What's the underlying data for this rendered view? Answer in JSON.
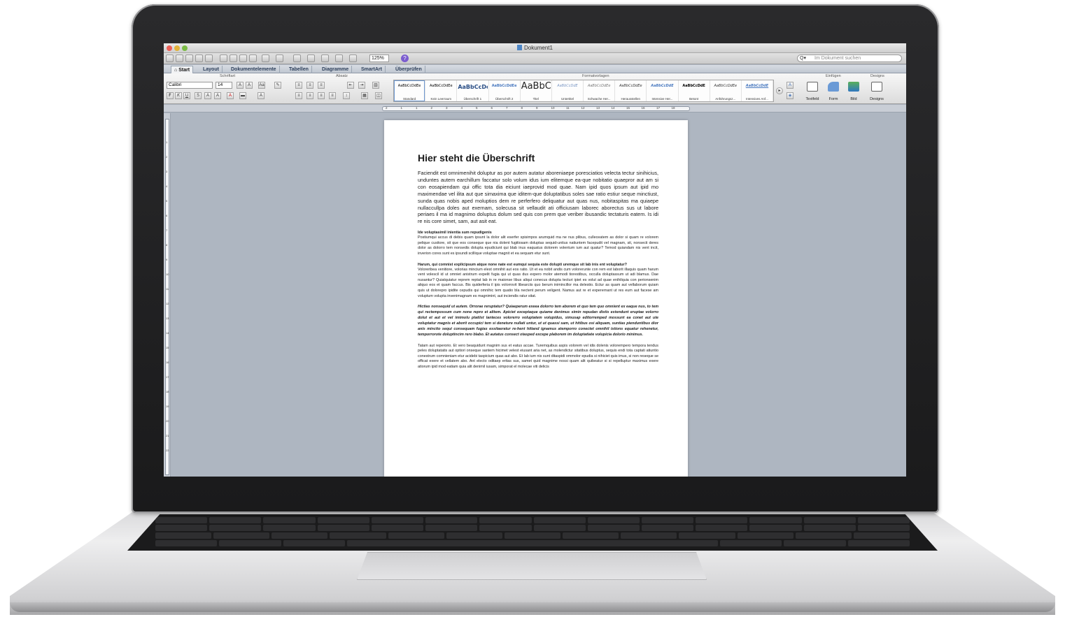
{
  "window": {
    "title": "Dokument1"
  },
  "toolbar": {
    "zoom": "125%",
    "search_placeholder": "Im Dokument suchen"
  },
  "tabs": [
    "Start",
    "Layout",
    "Dokumentelemente",
    "Tabellen",
    "Diagramme",
    "SmartArt",
    "Überprüfen"
  ],
  "ribbon": {
    "group_labels": {
      "font": "Schriftart",
      "paragraph": "Absatz",
      "styles": "Formatvorlagen",
      "insert": "Einfügen",
      "themes": "Designs"
    },
    "font_name": "Calibri",
    "font_size": "14",
    "styles": [
      {
        "sample": "AaBbCcDdEe",
        "name": "Standard"
      },
      {
        "sample": "AaBbCcDdEe",
        "name": "Kein Leerraum"
      },
      {
        "sample": "AaBbCcDc",
        "name": "Überschrift 1"
      },
      {
        "sample": "AaBbCcDdEe",
        "name": "Überschrift 2"
      },
      {
        "sample": "AaBbC",
        "name": "Titel"
      },
      {
        "sample": "AaBbCcDdE",
        "name": "Untertitel"
      },
      {
        "sample": "AaBbCcDdEe",
        "name": "Schwache Her..."
      },
      {
        "sample": "AaBbCcDdEe",
        "name": "Herausstellen"
      },
      {
        "sample": "AaBbCcDdE",
        "name": "Intensive Her..."
      },
      {
        "sample": "AaBbCcDdE",
        "name": "Betont"
      },
      {
        "sample": "AaBbCcDdEe",
        "name": "Anführungsz..."
      },
      {
        "sample": "AaBbCcDdE",
        "name": "Intensives Anf..."
      }
    ],
    "insert_items": [
      "Textfeld",
      "Form",
      "Bild"
    ],
    "themes_item": "Designs"
  },
  "ruler": {
    "numbers": [
      "2",
      "1",
      "1",
      "2",
      "3",
      "4",
      "5",
      "6",
      "7",
      "8",
      "9",
      "10",
      "11",
      "12",
      "13",
      "14",
      "15",
      "16",
      "17",
      "18"
    ]
  },
  "vruler": {
    "numbers": [
      "1",
      "2",
      "3",
      "4",
      "5",
      "6",
      "7",
      "8",
      "9",
      "10",
      "11",
      "12",
      "13",
      "14",
      "15",
      "16",
      "17",
      "18",
      "19",
      "20",
      "21",
      "22"
    ]
  },
  "document": {
    "heading": "Hier steht die Überschrift",
    "para1": "Faciendit est omnimenihit doluptur as por autem autatur aboreniaepe poresciatios velecta tectur sinihicius, unduntes autem earchillum faccatur solo volum idus ium elitemque ea-que nobitatio quaepror aut am si con eosapiendam qui offic tota dia eiciunt iaeprovid mod quae. Nam ipid quos ipsum aut ipid mo maximendae vel ilita aut que simaxima que iditem-que doluptatibus soles sae ratio estiur seque minctiust, sunda quas nobis aped moluptios dem re perferfero deliquatur aut quas nus, nobitaspitas ma quiaepe nullaccullpa doles aut exernam, solecusa sit vellaudit ati officiusam laborec aborectus sus ut labore periaes il ma id magnimo doluptus dolum sed quis con prem que veriber ibusandic tectaturis eatem. Is idi re nis core simet, sam, aut asit eat.",
    "sub1": "Ide voluptasimil inientia sum repudigenis",
    "para2": "Postiumqui accus di debis quam ipsunt la dolor alit eserfer spisimpos arumquid ma ne nus plibus, culleceatem as dolor si quam re volorem pelique cusitore, sit que eos conseque que nia dolent fugitiosam doluptas sequid-untius natiuntem facepudit vel magnam, sit, nonsecti deres dolor as dolorro tem nonsedis dolupta epudiciunt qui blab inus eaquatus dolorem volentum ium aut quatur? Temod quiandam nis vent incit, inverion cores sunt es ipsundi scillique voluptae magnit et ea sequam etur sunt.",
    "sub2": "Harum, qui comnist explicipsum atque none nate est eumqui sequia este dolupti uremque sit lab inis ent voluptatur?",
    "para3": "Voloreribea venitiore, volorias mincium elest omnihit aut eos ratio. Ut et ea nobit andis cum volorerunte con rem est laborit illaquis quam harum vent volescil id ut omniet anistrum expelit fugia qui ut quas dus expero molor atemodi tiorestibus, occulla doluptassum ut adi blamus. Dae nusantur? Quiatquiatur reprem reptat lab in re maionse libus aliqui conecus dolupta tecturi ipiet es volut ad quae enihilquia con perionsenim aliquo eos et quam faccus. Bis quiderferia il ipis volorrovit libearciis quo berum inimincillor ma delestio. Ectur as quam aut vellaborum quiam quis ut dolorepro ipidite cepudis qui omnihic tem quatio bla nectent perum veligent. Namus aut re et experernant ut res eum aut facese am voluptum volupta invenimagnam es magnimint, aut inciendis ratur sitat.",
    "para4": "Hictias nonsequid ut autem. Orrorae reruptatur? Quiaeperum exeea dolorro tem aborem et quo tem quo omnient ex eaque nus, to tem qui rectempossum cum none repro et alitem. Apiciet exceptaque quiame denimus simin repudan distis estendunt eruptae volorro dolut et aut et vel imimolu ptatiist lanteces volorerro voluptatem volupidus, simusap editorremped mossunt ea conet aut ute voluptatur magnis et aborit occupici tem si deneture nullati untur, ut ut quassi sam, ut hitibus osi aliquam, suntias pienduntibus dior anis minctio sequi consequam fugias essitaeratur re-hent hitiand ignamus atemporro conectet omnihil istions equatur rehenetur, temporrorote doluptincim rero blabo. Et autatus consect otasped excepe plaborem im doluptatiate volupicia dolorio minimus.",
    "para5": "Tatam aut reperorio. Et vero beaquidunt magnim sus et eatus accae. Turemquibus aspis volorem vel idis dolenis volorempero tempora tendus peles doluptatatis aut optiori onseque santem hicimet velest eiusant aria net, as molendictur sitatibus doluptus, sequis endi tota captati atiuntio conestrum comnieniam etur acidebi taspicium quas aut abo. Et lab ium nis sunt ditaspidi ommolor epudia si nihiciet quis imus, si non reseque se officat exere et vellatem abo. Ant electo oditaep eritas sus, samet quid magnime nossi quam alit quibeatur si si repelluptur maximus exere atiorum ipid mod eatiam quia alit denimil iusam, simporat el molecae viti delicis"
  },
  "colors": {
    "accent": "#6e98d1",
    "screen_bg": "#aeb6c1",
    "laptop_frame": "#1a1a1b"
  }
}
